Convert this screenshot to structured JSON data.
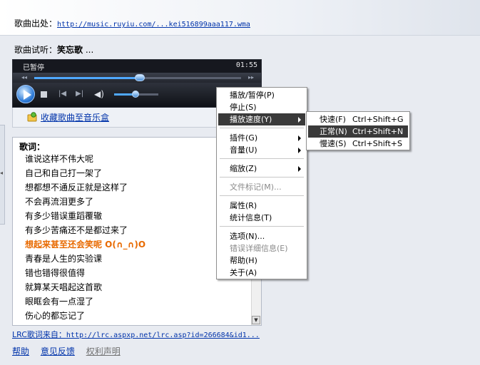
{
  "header": {
    "source_label": "歌曲出处：",
    "source_url": "http://music.ruyiu.com/...kei516899aaa117.wma"
  },
  "preview": {
    "label": "歌曲试听：",
    "song": "笑忘歌",
    "suffix": " ..."
  },
  "player": {
    "status": "已暂停",
    "time": "01:55",
    "seek_fraction": 0.51,
    "volume_fraction": 0.48,
    "nav_prev": "◂◂",
    "nav_next": "▸▸"
  },
  "favorite": {
    "label": "收藏歌曲至音乐盒"
  },
  "lyrics": {
    "heading": "歌词：",
    "lines": [
      "谁说这样不伟大呢",
      "自己和自己打一架了",
      "想都想不通反正就是这样了",
      "不会再流泪更多了",
      "有多少错误重蹈覆辙",
      "有多少苦痛还不是都过来了",
      "想起来甚至还会笑呢 O(∩_∩)O",
      "青春是人生的实验课",
      "错也错得很值得",
      "就算某天唱起这首歌",
      "眼眶会有一点湿了",
      "伤心的都忘记了"
    ],
    "active_index": 6
  },
  "lrc": {
    "label": "LRC歌词来自：",
    "url": "http://lrc.aspxp.net/lrc.asp?id=266684&id1..."
  },
  "footer": {
    "help": "帮助",
    "feedback": "意见反馈",
    "rights": "权利声明"
  },
  "context_menu": {
    "play_pause": "播放/暂停(P)",
    "stop": "停止(S)",
    "play_speed": "播放速度(Y)",
    "plugins": "插件(G)",
    "volume": "音量(U)",
    "zoom": "缩放(Z)",
    "file_markers": "文件标记(M)...",
    "properties": "属性(R)",
    "statistics": "统计信息(T)",
    "options": "选项(N)...",
    "error_details": "错误详细信息(E)",
    "help": "帮助(H)",
    "about": "关于(A)"
  },
  "speed_menu": {
    "fast": "快速(F)",
    "fast_shortcut": "Ctrl+Shift+G",
    "normal": "正常(N)",
    "normal_shortcut": "Ctrl+Shift+N",
    "slow": "慢速(S)",
    "slow_shortcut": "Ctrl+Shift+S"
  }
}
